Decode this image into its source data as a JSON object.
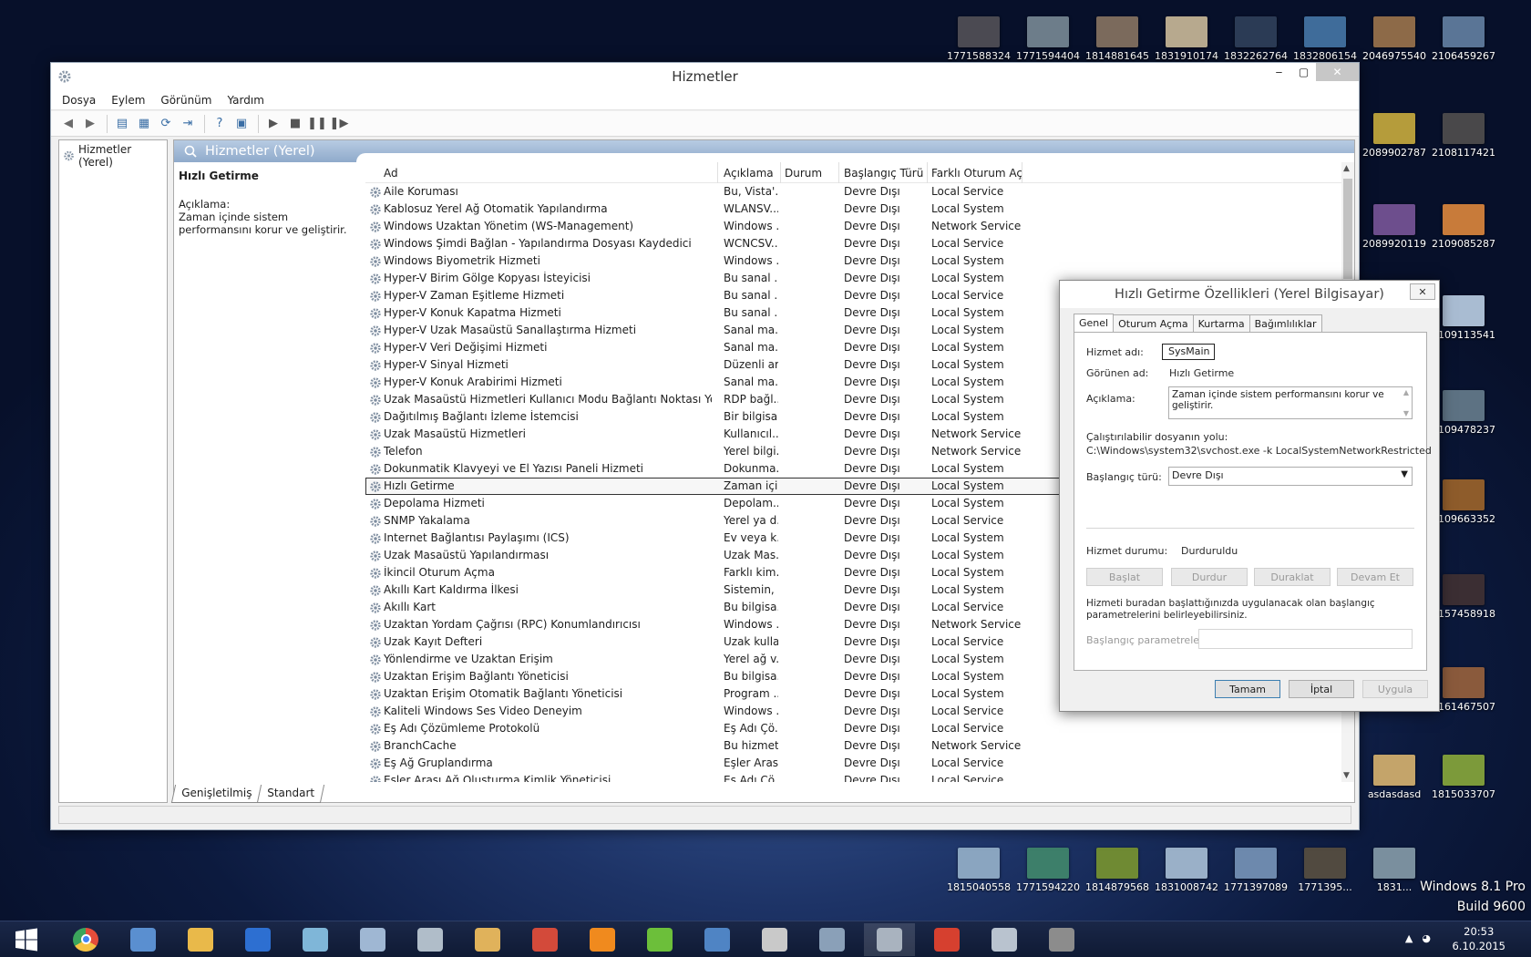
{
  "desktop": {
    "icons": [
      {
        "label": "1771588324...",
        "color": "#4b4a52"
      },
      {
        "label": "1771594404...",
        "color": "#6d7d8a"
      },
      {
        "label": "1814881645...",
        "color": "#7b6a5c"
      },
      {
        "label": "1831910174...",
        "color": "#b7a98e"
      },
      {
        "label": "1832262764...",
        "color": "#2b3b55"
      },
      {
        "label": "1832806154...",
        "color": "#3f6c9a"
      },
      {
        "label": "2046975540...",
        "color": "#8d6a48"
      },
      {
        "label": "2106459267...",
        "color": "#5a7596"
      },
      {
        "label": "2089902787...",
        "color": "#b59c3b"
      },
      {
        "label": "2108117421...",
        "color": "#49484a"
      },
      {
        "label": "2089920119...",
        "color": "#6d4e8d"
      },
      {
        "label": "2109085287...",
        "color": "#c87b3a"
      },
      {
        "label": "2109113541...",
        "color": "#a9bcd2"
      },
      {
        "label": "2109478237...",
        "color": "#5d7283"
      },
      {
        "label": "2109663352...",
        "color": "#8e5c2b"
      },
      {
        "label": "2157458918...",
        "color": "#3b2e33"
      },
      {
        "label": "2161467507...",
        "color": "#8a5a3c"
      },
      {
        "label": "asdasdasd",
        "color": "#c4a46a"
      },
      {
        "label": "1815033707...",
        "color": "#7c9a3a"
      },
      {
        "label": "1815040558...",
        "color": "#8aa5c0"
      },
      {
        "label": "1771594220...",
        "color": "#3d7f6a"
      },
      {
        "label": "1814879568...",
        "color": "#6f8a33"
      },
      {
        "label": "1831008742...",
        "color": "#9ab0c8"
      },
      {
        "label": "1771397089...",
        "color": "#6d89ad"
      },
      {
        "label": "1771395...",
        "color": "#514a40"
      },
      {
        "label": "1831...",
        "color": "#7a8f9e"
      }
    ],
    "watermark_line1": "Windows 8.1 Pro",
    "watermark_line2": "Build 9600"
  },
  "main_window": {
    "title": "Hizmetler",
    "controls": {
      "minimize": "‒",
      "maximize": "▢",
      "close": "✕"
    },
    "menu": [
      "Dosya",
      "Eylem",
      "Görünüm",
      "Yardım"
    ],
    "toolbar": [
      {
        "icon": "back-arrow-icon",
        "glyph": "◀"
      },
      {
        "icon": "forward-arrow-icon",
        "glyph": "▶"
      },
      {
        "icon": "show-tree-icon",
        "glyph": "▤"
      },
      {
        "icon": "properties-icon",
        "glyph": "▦"
      },
      {
        "icon": "refresh-icon",
        "glyph": "⟳"
      },
      {
        "icon": "export-icon",
        "glyph": "⇥"
      },
      {
        "icon": "help-icon",
        "glyph": "?"
      },
      {
        "icon": "console-icon",
        "glyph": "▣"
      },
      {
        "icon": "play-icon",
        "glyph": "▶"
      },
      {
        "icon": "stop-icon",
        "glyph": "■"
      },
      {
        "icon": "pause-icon",
        "glyph": "❚❚"
      },
      {
        "icon": "restart-icon",
        "glyph": "❚▶"
      }
    ],
    "tree_root": "Hizmetler (Yerel)",
    "panel_header": "Hizmetler (Yerel)",
    "details": {
      "service_name": "Hızlı Getirme",
      "desc_label": "Açıklama:",
      "desc_text": "Zaman içinde sistem performansını korur ve geliştirir."
    },
    "columns": [
      "Ad",
      "Açıklama",
      "Durum",
      "Başlangıç Türü",
      "Farklı Oturum Aç"
    ],
    "rows": [
      [
        "Aile Koruması",
        "Bu, Vista'...",
        "",
        "Devre Dışı",
        "Local Service"
      ],
      [
        "Kablosuz Yerel Ağ Otomatik Yapılandırma",
        "WLANSV...",
        "",
        "Devre Dışı",
        "Local System"
      ],
      [
        "Windows Uzaktan Yönetim (WS-Management)",
        "Windows ...",
        "",
        "Devre Dışı",
        "Network Service"
      ],
      [
        "Windows Şimdi Bağlan - Yapılandırma Dosyası Kaydedici",
        "WCNCSV...",
        "",
        "Devre Dışı",
        "Local Service"
      ],
      [
        "Windows Biyometrik Hizmeti",
        "Windows ...",
        "",
        "Devre Dışı",
        "Local System"
      ],
      [
        "Hyper-V Birim Gölge Kopyası İsteyicisi",
        "Bu sanal ...",
        "",
        "Devre Dışı",
        "Local System"
      ],
      [
        "Hyper-V Zaman Eşitleme Hizmeti",
        "Bu sanal ...",
        "",
        "Devre Dışı",
        "Local Service"
      ],
      [
        "Hyper-V Konuk Kapatma Hizmeti",
        "Bu sanal ...",
        "",
        "Devre Dışı",
        "Local System"
      ],
      [
        "Hyper-V Uzak Masaüstü Sanallaştırma Hizmeti",
        "Sanal ma...",
        "",
        "Devre Dışı",
        "Local System"
      ],
      [
        "Hyper-V Veri Değişimi Hizmeti",
        "Sanal ma...",
        "",
        "Devre Dışı",
        "Local System"
      ],
      [
        "Hyper-V Sinyal Hizmeti",
        "Düzenli ar...",
        "",
        "Devre Dışı",
        "Local System"
      ],
      [
        "Hyper-V Konuk Arabirimi Hizmeti",
        "Sanal ma...",
        "",
        "Devre Dışı",
        "Local System"
      ],
      [
        "Uzak Masaüstü Hizmetleri Kullanıcı Modu Bağlantı Noktası Yeniden ...",
        "RDP bağl...",
        "",
        "Devre Dışı",
        "Local System"
      ],
      [
        "Dağıtılmış Bağlantı İzleme İstemcisi",
        "Bir bilgisa...",
        "",
        "Devre Dışı",
        "Local System"
      ],
      [
        "Uzak Masaüstü Hizmetleri",
        "Kullanıcıl...",
        "",
        "Devre Dışı",
        "Network Service"
      ],
      [
        "Telefon",
        "Yerel bilgi...",
        "",
        "Devre Dışı",
        "Network Service"
      ],
      [
        "Dokunmatik Klavyeyi ve El Yazısı Paneli Hizmeti",
        "Dokunma...",
        "",
        "Devre Dışı",
        "Local System"
      ],
      [
        "Hızlı Getirme",
        "Zaman içi...",
        "",
        "Devre Dışı",
        "Local System"
      ],
      [
        "Depolama Hizmeti",
        "Depolam...",
        "",
        "Devre Dışı",
        "Local System"
      ],
      [
        "SNMP Yakalama",
        "Yerel ya d...",
        "",
        "Devre Dışı",
        "Local Service"
      ],
      [
        "Internet Bağlantısı Paylaşımı (ICS)",
        "Ev veya k...",
        "",
        "Devre Dışı",
        "Local System"
      ],
      [
        "Uzak Masaüstü Yapılandırması",
        "Uzak Mas...",
        "",
        "Devre Dışı",
        "Local System"
      ],
      [
        "İkincil Oturum Açma",
        "Farklı kim...",
        "",
        "Devre Dışı",
        "Local System"
      ],
      [
        "Akıllı Kart Kaldırma İlkesi",
        "Sistemin, ...",
        "",
        "Devre Dışı",
        "Local System"
      ],
      [
        "Akıllı Kart",
        "Bu bilgisa...",
        "",
        "Devre Dışı",
        "Local Service"
      ],
      [
        "Uzaktan Yordam Çağrısı (RPC) Konumlandırıcısı",
        "Windows ...",
        "",
        "Devre Dışı",
        "Network Service"
      ],
      [
        "Uzak Kayıt Defteri",
        "Uzak kulla...",
        "",
        "Devre Dışı",
        "Local Service"
      ],
      [
        "Yönlendirme ve Uzaktan Erişim",
        "Yerel ağ v...",
        "",
        "Devre Dışı",
        "Local System"
      ],
      [
        "Uzaktan Erişim Bağlantı Yöneticisi",
        "Bu bilgisa...",
        "",
        "Devre Dışı",
        "Local System"
      ],
      [
        "Uzaktan Erişim Otomatik Bağlantı Yöneticisi",
        "Program ...",
        "",
        "Devre Dışı",
        "Local System"
      ],
      [
        "Kaliteli Windows Ses Video Deneyim",
        "Windows ...",
        "",
        "Devre Dışı",
        "Local Service"
      ],
      [
        "Eş Adı Çözümleme Protokolü",
        "Eş Adı Çö...",
        "",
        "Devre Dışı",
        "Local Service"
      ],
      [
        "BranchCache",
        "Bu hizmet...",
        "",
        "Devre Dışı",
        "Network Service"
      ],
      [
        "Eş Ağ Gruplandırma",
        "Eşler Arası...",
        "",
        "Devre Dışı",
        "Local Service"
      ],
      [
        "Eşler Arası Ağ Oluşturma Kimlik Yöneticisi",
        "Eş Adı Çö...",
        "",
        "Devre Dışı",
        "Local Service"
      ]
    ],
    "selected_row": 17,
    "tabs": [
      "Genişletilmiş",
      "Standart"
    ]
  },
  "dialog": {
    "title": "Hızlı Getirme Özellikleri (Yerel Bilgisayar)",
    "close": "✕",
    "tabs": [
      "Genel",
      "Oturum Açma",
      "Kurtarma",
      "Bağımlılıklar"
    ],
    "active_tab": 0,
    "service_name_label": "Hizmet adı:",
    "service_name": "SysMain",
    "display_name_label": "Görünen ad:",
    "display_name": "Hızlı Getirme",
    "desc_label": "Açıklama:",
    "desc": "Zaman içinde sistem performansını korur ve geliştirir.",
    "path_label": "Çalıştırılabilir dosyanın yolu:",
    "path": "C:\\Windows\\system32\\svchost.exe -k LocalSystemNetworkRestricted",
    "startup_label": "Başlangıç türü:",
    "startup_value": "Devre Dışı",
    "status_label": "Hizmet durumu:",
    "status_value": "Durduruldu",
    "buttons": {
      "start": "Başlat",
      "stop": "Durdur",
      "pause": "Duraklat",
      "resume": "Devam Et"
    },
    "hint": "Hizmeti buradan başlattığınızda uygulanacak olan başlangıç parametrelerini belirleyebilirsiniz.",
    "params_label": "Başlangıç parametreleri:",
    "ok": "Tamam",
    "cancel": "İptal",
    "apply": "Uygula"
  },
  "taskbar": {
    "apps": [
      {
        "name": "start",
        "color": "#ffffff"
      },
      {
        "name": "chrome",
        "color": "#e44d3a"
      },
      {
        "name": "remote-desktop",
        "color": "#5a8fd0"
      },
      {
        "name": "explorer",
        "color": "#e9b94a"
      },
      {
        "name": "app-blue",
        "color": "#2d6fd1"
      },
      {
        "name": "app-slate",
        "color": "#7fb6d8"
      },
      {
        "name": "calculator",
        "color": "#9fb7d3"
      },
      {
        "name": "resource-monitor",
        "color": "#b0bdc9"
      },
      {
        "name": "paint",
        "color": "#e0b25b"
      },
      {
        "name": "paint-tool",
        "color": "#d34a3a"
      },
      {
        "name": "app-orange",
        "color": "#f08a1e"
      },
      {
        "name": "utorrent",
        "color": "#6cbf3a"
      },
      {
        "name": "r-app",
        "color": "#4f84c4"
      },
      {
        "name": "gif-app",
        "color": "#c9c9c9"
      },
      {
        "name": "monitor-app",
        "color": "#8aa0b8"
      },
      {
        "name": "services",
        "color": "#a9b3bf"
      },
      {
        "name": "ccleaner",
        "color": "#d6402f"
      },
      {
        "name": "camera-app",
        "color": "#b9c3cf"
      },
      {
        "name": "settings-gear",
        "color": "#8c8c8c"
      }
    ],
    "active_index": 15,
    "time": "20:53",
    "date": "6.10.2015"
  }
}
